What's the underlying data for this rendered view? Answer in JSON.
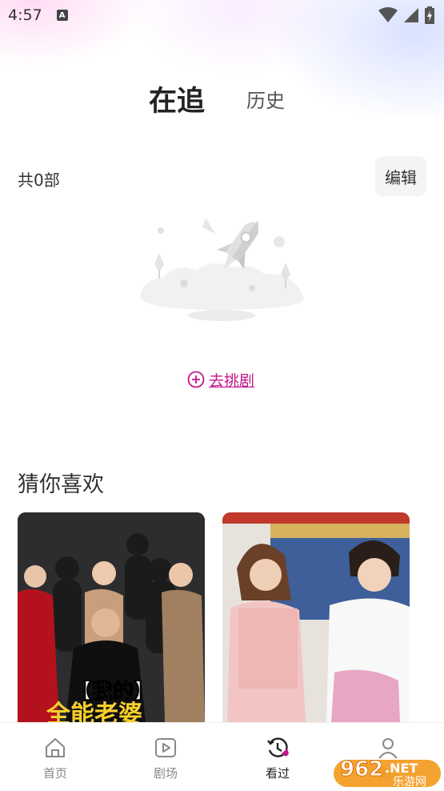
{
  "status_bar": {
    "time": "4:57",
    "notification_icon": "A"
  },
  "tabs": [
    {
      "label": "在追",
      "active": true
    },
    {
      "label": "历史",
      "active": false
    }
  ],
  "toolbar": {
    "count_text": "共0部",
    "edit_label": "编辑"
  },
  "empty_state": {
    "action_label": "去挑剧",
    "accent_color": "#c3158a"
  },
  "recommend": {
    "title": "猜你喜欢",
    "cards": [
      {
        "caption": "【我的】",
        "caption_line2": "全能老婆"
      },
      {
        "caption": ""
      }
    ]
  },
  "bottom_nav": [
    {
      "label": "首页",
      "icon": "home-icon",
      "active": false
    },
    {
      "label": "剧场",
      "icon": "play-icon",
      "active": false
    },
    {
      "label": "看过",
      "icon": "history-icon",
      "active": true
    },
    {
      "label": "我的",
      "icon": "user-icon",
      "active": false
    }
  ],
  "watermark": {
    "number": "962",
    "suffix": ".NET",
    "text": "乐游网"
  }
}
